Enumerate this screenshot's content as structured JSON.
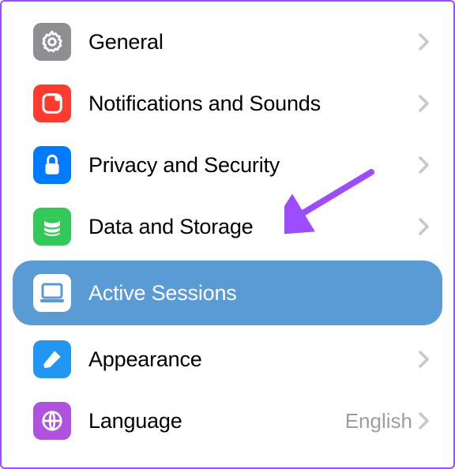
{
  "settings": {
    "items": [
      {
        "id": "general",
        "label": "General",
        "icon": "gear-icon",
        "color": "#8e8e93",
        "selected": false,
        "value": null,
        "chevron": true
      },
      {
        "id": "notifications",
        "label": "Notifications and Sounds",
        "icon": "bell-icon",
        "color": "#ff3b30",
        "selected": false,
        "value": null,
        "chevron": true
      },
      {
        "id": "privacy",
        "label": "Privacy and Security",
        "icon": "lock-icon",
        "color": "#007aff",
        "selected": false,
        "value": null,
        "chevron": true
      },
      {
        "id": "data",
        "label": "Data and Storage",
        "icon": "database-icon",
        "color": "#34c759",
        "selected": false,
        "value": null,
        "chevron": true
      },
      {
        "id": "sessions",
        "label": "Active Sessions",
        "icon": "laptop-icon",
        "color": "#ffffff",
        "selected": true,
        "value": null,
        "chevron": false
      },
      {
        "id": "appearance",
        "label": "Appearance",
        "icon": "brush-icon",
        "color": "#2196f3",
        "selected": false,
        "value": null,
        "chevron": true
      },
      {
        "id": "language",
        "label": "Language",
        "icon": "globe-icon",
        "color": "#af52de",
        "selected": false,
        "value": "English",
        "chevron": true
      }
    ]
  },
  "annotation": {
    "arrow_color": "#9b4dff"
  }
}
